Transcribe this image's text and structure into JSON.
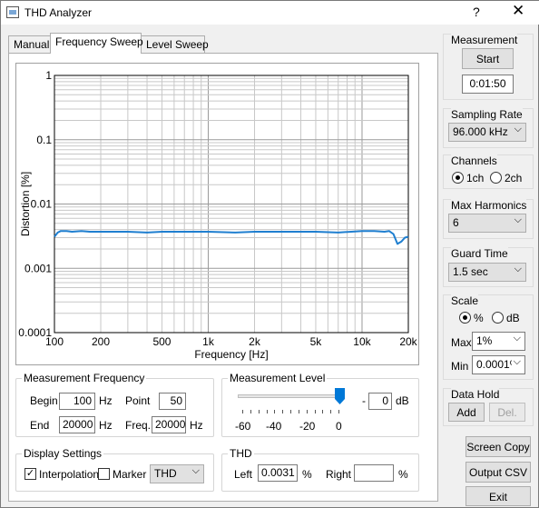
{
  "window": {
    "title": "THD Analyzer",
    "help_label": "?",
    "close_label": "✕"
  },
  "tabs": [
    {
      "label": "Manual"
    },
    {
      "label": "Frequency Sweep"
    },
    {
      "label": "Level Sweep"
    }
  ],
  "colors": {
    "trace": "#1f7fd0",
    "grid": "#c8c8c8",
    "panel": "#f0f0f0"
  },
  "chart_data": {
    "type": "line",
    "xlabel": "Frequency [Hz]",
    "ylabel": "Distortion [%]",
    "x_scale": "log",
    "y_scale": "log",
    "xlim": [
      100,
      20000
    ],
    "ylim": [
      0.0001,
      1
    ],
    "x_ticks": [
      "100",
      "200",
      "500",
      "1k",
      "2k",
      "5k",
      "10k",
      "20k"
    ],
    "y_ticks": [
      "1",
      "0.1",
      "0.01",
      "0.001",
      "0.0001"
    ],
    "grid": true,
    "series": [
      {
        "x": [
          100,
          105,
          110,
          120,
          130,
          150,
          170,
          200,
          250,
          300,
          400,
          500,
          700,
          1000,
          1500,
          2000,
          3000,
          5000,
          7000,
          10000,
          12000,
          14000,
          15000,
          16000,
          17000,
          18000,
          19000,
          20000
        ],
        "y": [
          0.0031,
          0.0036,
          0.0038,
          0.0038,
          0.0037,
          0.0038,
          0.0037,
          0.0037,
          0.0037,
          0.0037,
          0.0036,
          0.0037,
          0.0037,
          0.0037,
          0.0036,
          0.0037,
          0.0037,
          0.0037,
          0.0036,
          0.0038,
          0.0038,
          0.0037,
          0.0038,
          0.0034,
          0.0024,
          0.0026,
          0.003,
          0.0031
        ]
      }
    ]
  },
  "measurement_frequency": {
    "title": "Measurement Frequency",
    "begin_label": "Begin",
    "begin_value": "100",
    "begin_unit": "Hz",
    "point_label": "Point",
    "point_value": "50",
    "end_label": "End",
    "end_value": "20000",
    "end_unit": "Hz",
    "freq_label": "Freq.",
    "freq_value": "20000",
    "freq_unit": "Hz"
  },
  "measurement_level": {
    "title": "Measurement Level",
    "ticks": [
      "-60",
      "-40",
      "-20",
      "0"
    ],
    "slider_fraction": 1.0,
    "minus_label": "-",
    "value": "0",
    "unit": "dB"
  },
  "display_settings": {
    "title": "Display Settings",
    "interpolation_label": "Interpolation",
    "interpolation_checked": "✓",
    "marker_label": "Marker",
    "mode_value": "THD"
  },
  "thd": {
    "title": "THD",
    "left_label": "Left",
    "left_value": "0.0031",
    "left_unit": "%",
    "right_label": "Right",
    "right_value": "",
    "right_unit": "%"
  },
  "measurement": {
    "title": "Measurement",
    "start_label": "Start",
    "timer": "0:01:50"
  },
  "sampling_rate": {
    "title": "Sampling Rate",
    "value": "96.000 kHz"
  },
  "channels": {
    "title": "Channels",
    "opt1": "1ch",
    "opt2": "2ch"
  },
  "max_harmonics": {
    "title": "Max Harmonics",
    "value": "6"
  },
  "guard_time": {
    "title": "Guard Time",
    "value": "1.5 sec"
  },
  "scale": {
    "title": "Scale",
    "opt_pct": "%",
    "opt_db": "dB",
    "max_label": "Max",
    "max_value": "1%",
    "min_label": "Min",
    "min_value": "0.0001%"
  },
  "data_hold": {
    "title": "Data Hold",
    "add_label": "Add",
    "del_label": "Del."
  },
  "buttons": {
    "screen_copy": "Screen Copy",
    "output_csv": "Output CSV",
    "exit": "Exit"
  }
}
